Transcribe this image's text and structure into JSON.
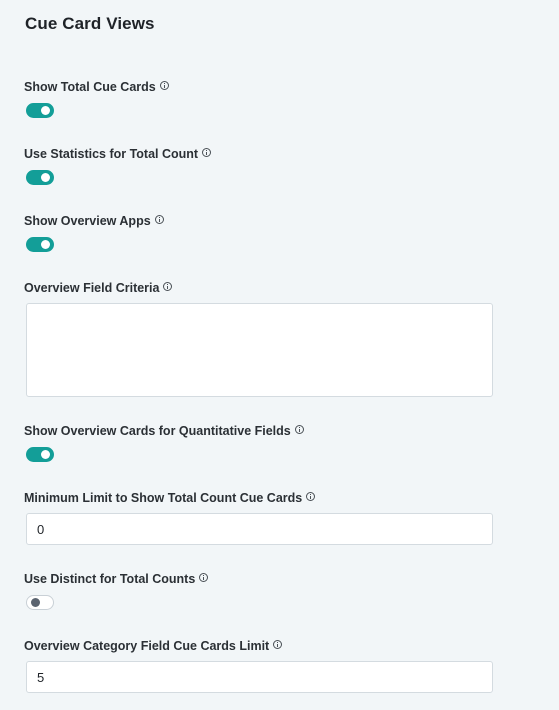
{
  "title": "Cue Card Views",
  "settings": {
    "show_total_cue_cards": {
      "label": "Show Total Cue Cards",
      "enabled": true
    },
    "use_statistics": {
      "label": "Use Statistics for Total Count",
      "enabled": true
    },
    "show_overview_apps": {
      "label": "Show Overview Apps",
      "enabled": true
    },
    "overview_field_criteria": {
      "label": "Overview Field Criteria",
      "value": ""
    },
    "show_overview_quant": {
      "label": "Show Overview Cards for Quantitative Fields",
      "enabled": true
    },
    "min_limit_total_count": {
      "label": "Minimum Limit to Show Total Count Cue Cards",
      "value": "0"
    },
    "use_distinct": {
      "label": "Use Distinct for Total Counts",
      "enabled": false
    },
    "overview_category_limit": {
      "label": "Overview Category Field Cue Cards Limit",
      "value": "5"
    }
  },
  "colors": {
    "toggle_on": "#139e98",
    "background": "#f2f6f8"
  },
  "icons": {
    "info": "info-icon"
  }
}
